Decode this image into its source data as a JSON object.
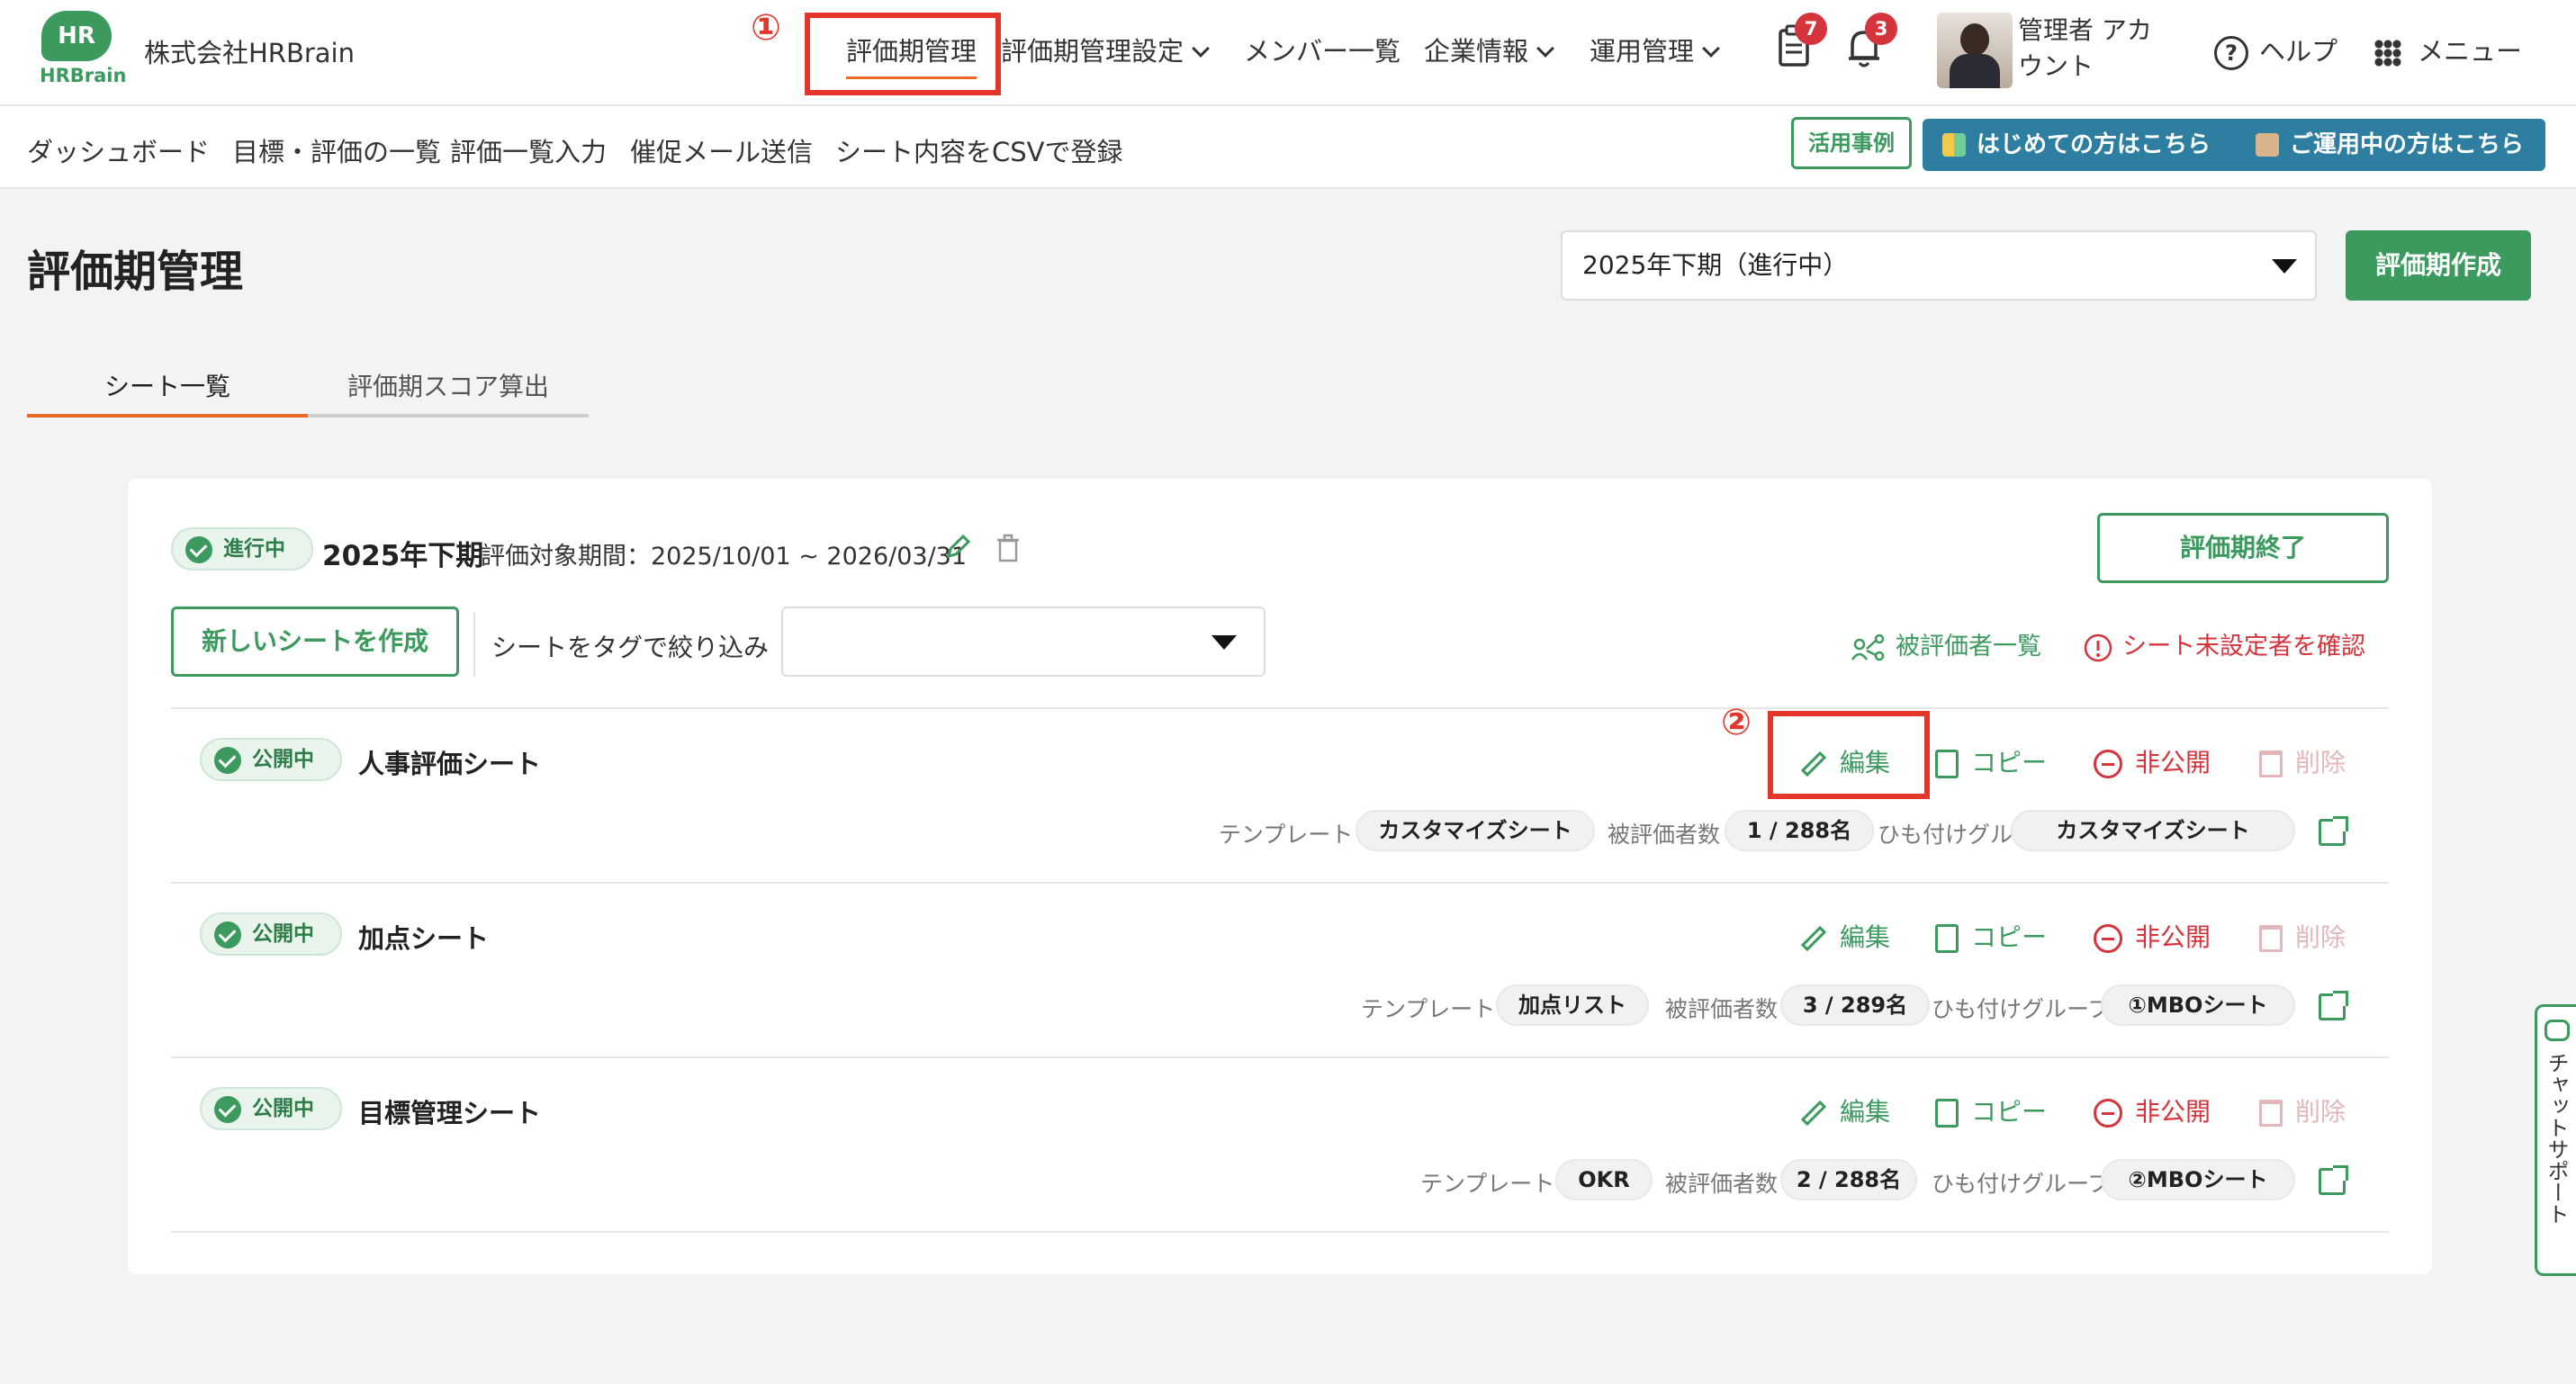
{
  "header": {
    "logo_text": "HR",
    "logo_word": "HRBrain",
    "company": "株式会社HRBrain",
    "nav": [
      {
        "label": "評価期管理",
        "active": true
      },
      {
        "label": "評価期管理設定",
        "dropdown": true
      },
      {
        "label": "メンバー一覧"
      },
      {
        "label": "企業情報",
        "dropdown": true
      },
      {
        "label": "運用管理",
        "dropdown": true
      }
    ],
    "tasks_count": "7",
    "notifications_count": "3",
    "user_name": "管理者 アカウント",
    "help_label": "ヘルプ",
    "menu_label": "メニュー"
  },
  "subnav": {
    "items": [
      "ダッシュボード",
      "目標・評価の一覧",
      "評価一覧入力",
      "催促メール送信",
      "シート内容をCSVで登録"
    ],
    "case_button": "活用事例",
    "beginner_button": "はじめての方はこちら",
    "in_use_button": "ご運用中の方はこちら"
  },
  "page": {
    "title": "評価期管理",
    "period_select_value": "2025年下期（進行中）",
    "create_period_button": "評価期作成",
    "tabs": [
      "シート一覧",
      "評価期スコア算出"
    ]
  },
  "term": {
    "status": "進行中",
    "name": "2025年下期",
    "period": "評価対象期間：2025/10/01 ~ 2026/03/31",
    "end_button": "評価期終了",
    "create_sheet_button": "新しいシートを作成",
    "filter_label": "シートをタグで絞り込み",
    "evaluatees_link": "被評価者一覧",
    "unset_link": "シート未設定者を確認"
  },
  "labels": {
    "template": "テンプレート",
    "evaluatee_count": "被評価者数",
    "group": "ひも付けグループ",
    "edit": "編集",
    "copy": "コピー",
    "unpublish": "非公開",
    "delete": "削除"
  },
  "sheets": [
    {
      "status": "公開中",
      "name": "人事評価シート",
      "template": "カスタマイズシート",
      "count": "1 / 288名",
      "group": "カスタマイズシート"
    },
    {
      "status": "公開中",
      "name": "加点シート",
      "template": "加点リスト",
      "count": "3 / 289名",
      "group": "①MBOシート"
    },
    {
      "status": "公開中",
      "name": "目標管理シート",
      "template": "OKR",
      "count": "2 / 288名",
      "group": "②MBOシート"
    }
  ],
  "annotations": {
    "step1": "①",
    "step2": "②"
  },
  "chat_support": "チャットサポート",
  "colors": {
    "brand_green": "#3c9a5f",
    "accent_orange": "#e86a25",
    "annotation_red": "#e3372b",
    "button_blue": "#2d7ea0"
  }
}
